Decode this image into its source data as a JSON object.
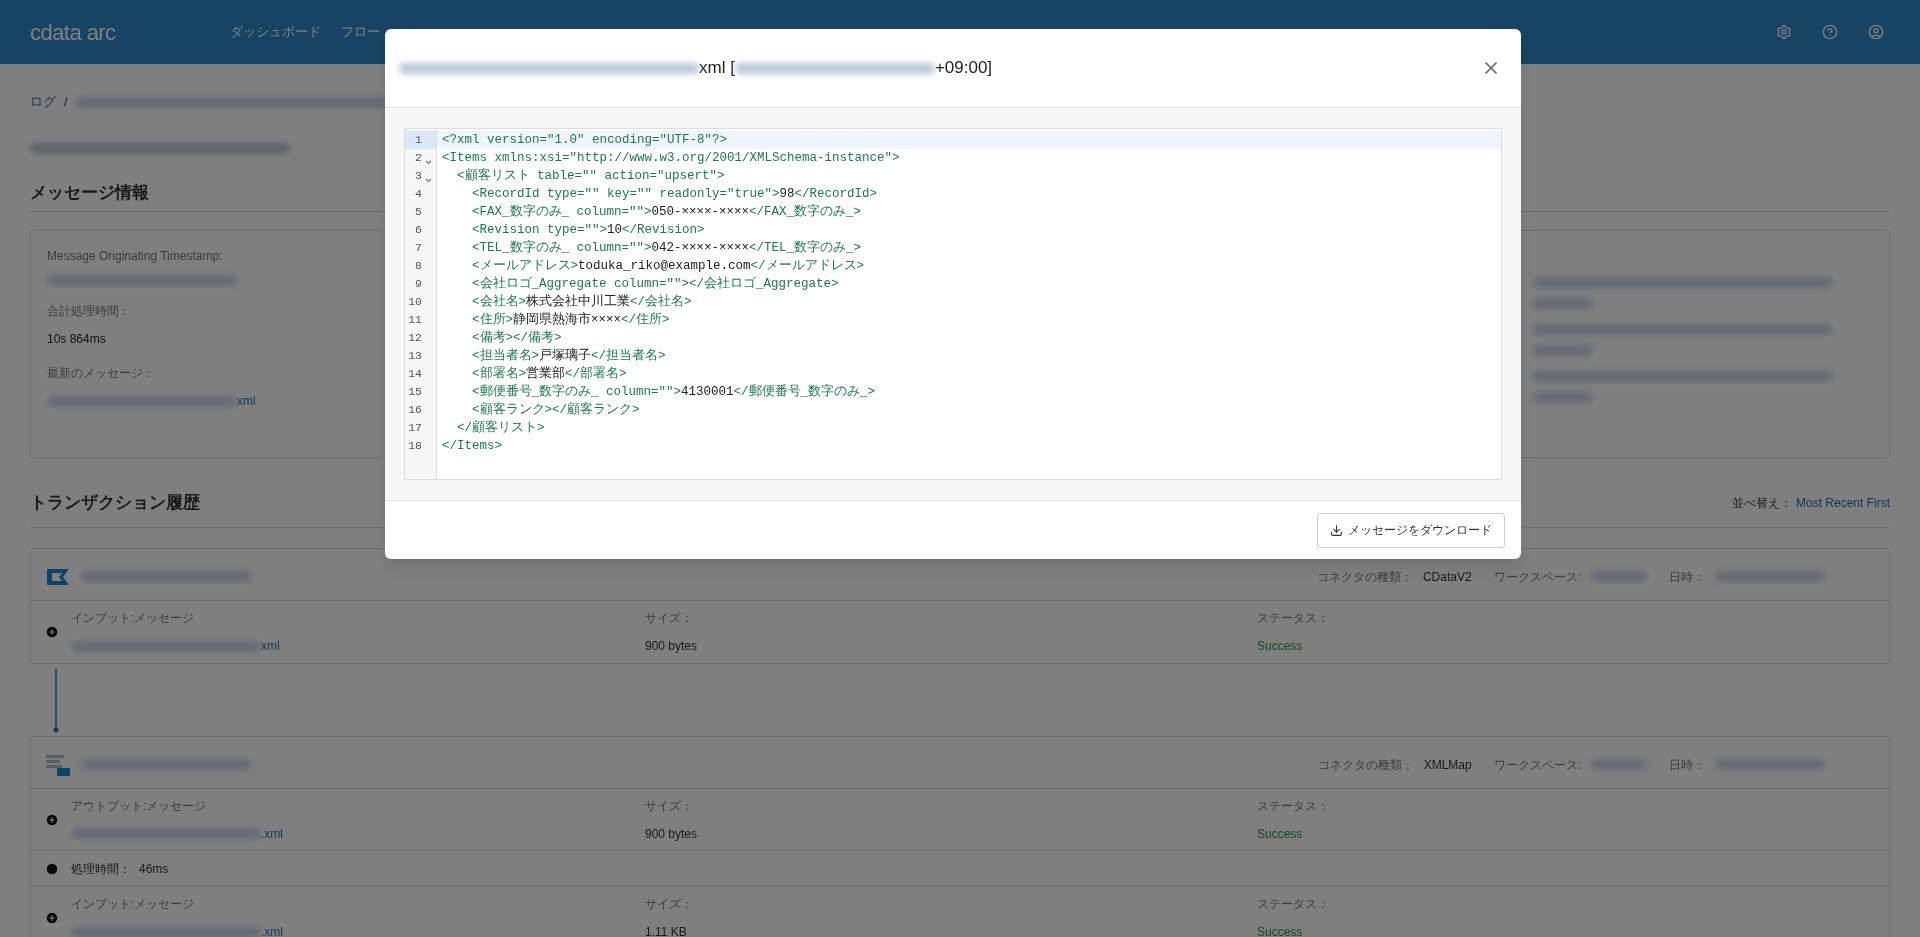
{
  "header": {
    "logo": "cdata arc",
    "nav": [
      {
        "label": "ダッシュボード",
        "selected": false
      },
      {
        "label": "フロー",
        "selected": false
      }
    ]
  },
  "breadcrumb": {
    "root": "ログ",
    "separator": "/"
  },
  "message_info": {
    "heading": "メッセージ情報",
    "fields": [
      {
        "label": "Message Originating Timestamp:",
        "value": [
          {
            "kind": "redacted"
          }
        ]
      },
      {
        "label": "合計処理時間：",
        "value": [
          {
            "kind": "text",
            "text": "10s 864ms"
          }
        ]
      },
      {
        "label": "最新のメッセージ：",
        "value": [
          {
            "kind": "redacted"
          },
          {
            "kind": "link",
            "text": "xml"
          }
        ]
      }
    ]
  },
  "transactions": {
    "heading": "トランザクション履歴",
    "sort_label": "並べ替え：",
    "sort_value": "Most Recent First",
    "connectors": [
      {
        "kind": "cdata",
        "type_label": "コネクタの種類：",
        "type_value": "CDataV2",
        "workspace_label": "ワークスペース:",
        "date_label": "日時：",
        "rows": [
          {
            "kind": "message",
            "label": "インプット:メッセージ",
            "file": "xml",
            "size_label": "サイズ：",
            "size": "900 bytes",
            "status_label": "ステータス：",
            "status": "Success"
          }
        ]
      },
      {
        "kind": "xmlmap",
        "type_label": "コネクタの種類：",
        "type_value": "XMLMap",
        "workspace_label": "ワークスペース:",
        "date_label": "日時：",
        "rows": [
          {
            "kind": "message",
            "label": "アウトプット:メッセージ",
            "file": ".xml",
            "size_label": "サイズ：",
            "size": "900 bytes",
            "status_label": "ステータス：",
            "status": "Success"
          },
          {
            "kind": "time",
            "label": "処理時間：",
            "value": "46ms"
          },
          {
            "kind": "message",
            "label": "インプット:メッセージ",
            "file": ".xml",
            "size_label": "サイズ：",
            "size": "1.11 KB",
            "status_label": "ステータス：",
            "status": "Success"
          }
        ]
      }
    ]
  },
  "modal": {
    "title": [
      {
        "kind": "redacted"
      },
      {
        "kind": "text",
        "text": "xml ["
      },
      {
        "kind": "redacted"
      },
      {
        "kind": "text",
        "text": "+09:00]"
      }
    ],
    "lines": [
      {
        "number": "1",
        "text": "<?xml version=\"1.0\" encoding=\"UTF-8\"?>",
        "foldable": false,
        "selected": true
      },
      {
        "number": "2",
        "text": "<Items xmlns:xsi=\"http://www.w3.org/2001/XMLSchema-instance\">",
        "foldable": true,
        "selected": false
      },
      {
        "number": "3",
        "text": "  <顧客リスト table=\"\" action=\"upsert\">",
        "foldable": true,
        "selected": false
      },
      {
        "number": "4",
        "text": "    <RecordId type=\"\" key=\"\" readonly=\"true\">98</RecordId>",
        "foldable": false,
        "selected": false
      },
      {
        "number": "5",
        "text": "    <FAX_数字のみ_ column=\"\">050-××××-××××</FAX_数字のみ_>",
        "foldable": false,
        "selected": false
      },
      {
        "number": "6",
        "text": "    <Revision type=\"\">10</Revision>",
        "foldable": false,
        "selected": false
      },
      {
        "number": "7",
        "text": "    <TEL_数字のみ_ column=\"\">042-××××-××××</TEL_数字のみ_>",
        "foldable": false,
        "selected": false
      },
      {
        "number": "8",
        "text": "    <メールアドレス>toduka_riko@example.com</メールアドレス>",
        "foldable": false,
        "selected": false
      },
      {
        "number": "9",
        "text": "    <会社ロゴ_Aggregate column=\"\"></会社ロゴ_Aggregate>",
        "foldable": false,
        "selected": false
      },
      {
        "number": "10",
        "text": "    <会社名>株式会社中川工業</会社名>",
        "foldable": false,
        "selected": false
      },
      {
        "number": "11",
        "text": "    <住所>静岡県熱海市××××</住所>",
        "foldable": false,
        "selected": false
      },
      {
        "number": "12",
        "text": "    <備考></備考>",
        "foldable": false,
        "selected": false
      },
      {
        "number": "13",
        "text": "    <担当者名>戸塚璃子</担当者名>",
        "foldable": false,
        "selected": false
      },
      {
        "number": "14",
        "text": "    <部署名>営業部</部署名>",
        "foldable": false,
        "selected": false
      },
      {
        "number": "15",
        "text": "    <郵便番号_数字のみ_ column=\"\">4130001</郵便番号_数字のみ_>",
        "foldable": false,
        "selected": false
      },
      {
        "number": "16",
        "text": "    <顧客ランク></顧客ランク>",
        "foldable": false,
        "selected": false
      },
      {
        "number": "17",
        "text": "  </顧客リスト>",
        "foldable": false,
        "selected": false
      },
      {
        "number": "18",
        "text": "</Items>",
        "foldable": false,
        "selected": false
      }
    ],
    "download_button": "メッセージをダウンロード"
  }
}
